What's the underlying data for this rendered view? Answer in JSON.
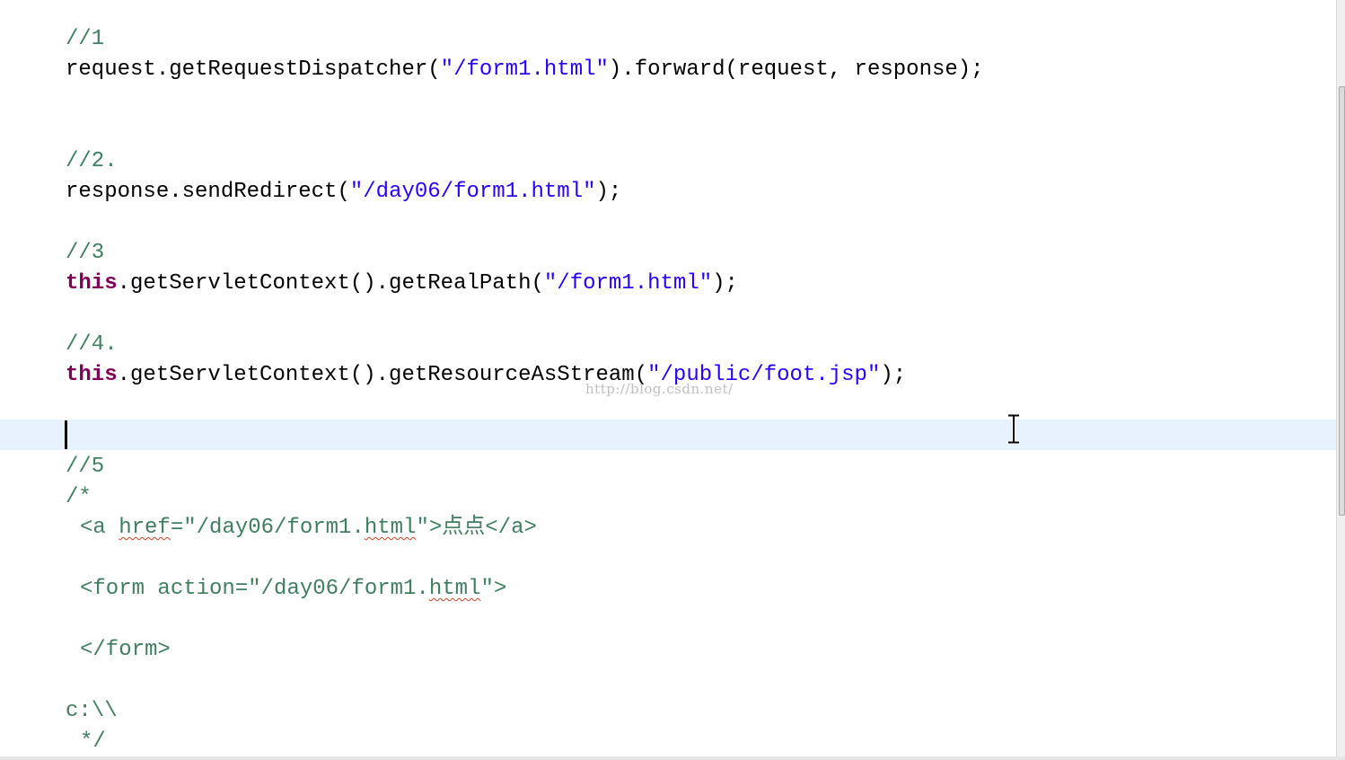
{
  "editor": {
    "lines": {
      "l1": {
        "comment": "//1"
      },
      "l2": {
        "a": "request.getRequestDispatcher(",
        "s": "\"/form1.html\"",
        "b": ").forward(request, response);"
      },
      "l3": {
        "comment": "//2."
      },
      "l4": {
        "a": "response.sendRedirect(",
        "s": "\"/day06/form1.html\"",
        "b": ");"
      },
      "l5": {
        "comment": "//3"
      },
      "l6": {
        "kw": "this",
        "a": ".getServletContext().getRealPath(",
        "s": "\"/form1.html\"",
        "b": ");"
      },
      "l7": {
        "comment": "//4."
      },
      "l8": {
        "kw": "this",
        "a": ".getServletContext().getResourceAsStream(",
        "s": "\"/public/foot.jsp\"",
        "b": ");"
      },
      "l9": {
        "comment": "//5"
      },
      "l10": {
        "comment": "/*"
      },
      "l11": {
        "p1": "<a ",
        "w1": "href",
        "p2": "=\"/day06/form1.",
        "w2": "html",
        "p3": "\">点点</a>"
      },
      "l12": {
        "p1": "<form action=\"/day06/form1.",
        "w1": "html",
        "p2": "\">"
      },
      "l13": {
        "comment": "</form>"
      },
      "l14": {
        "comment": "c:\\\\"
      },
      "l15": {
        "comment": "*/"
      }
    }
  },
  "watermark": "http://blog.csdn.net/"
}
